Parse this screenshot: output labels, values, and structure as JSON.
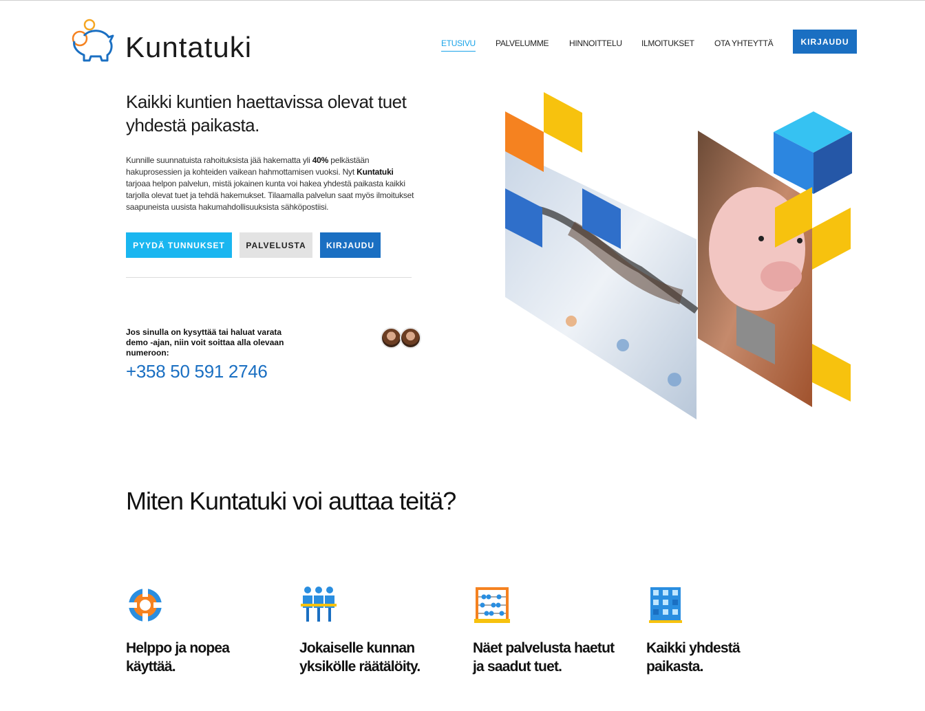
{
  "brand": {
    "name": "Kuntatuki"
  },
  "nav": {
    "items": [
      {
        "label": "ETUSIVU",
        "active": true
      },
      {
        "label": "PALVELUMME",
        "active": false
      },
      {
        "label": "HINNOITTELU",
        "active": false
      },
      {
        "label": "ILMOITUKSET",
        "active": false
      },
      {
        "label": "OTA YHTEYTTÄ",
        "active": false
      }
    ],
    "login_label": "KIRJAUDU"
  },
  "hero": {
    "title": "Kaikki kuntien haettavissa olevat tuet yhdestä paikasta.",
    "text_1": "Kunnille suunnatuista rahoituksista jää hakematta yli ",
    "text_bold_1": "40%",
    "text_2": " pelkästään hakuprosessien ja kohteiden vaikean hahmottamisen vuoksi. Nyt ",
    "text_bold_2": "Kuntatuki",
    "text_3": " tarjoaa helpon palvelun, mistä jokainen kunta voi hakea yhdestä paikasta kaikki tarjolla olevat tuet ja tehdä hakemukset. Tilaamalla palvelun saat myös ilmoitukset saapuneista uusista hakumahdollisuuksista sähköpostiisi.",
    "buttons": {
      "request": "PYYDÄ TUNNUKSET",
      "service": "PALVELUSTA",
      "login": "KIRJAUDU"
    }
  },
  "contact": {
    "text": "Jos sinulla on kysyttää tai haluat varata demo -ajan, niin voit soittaa alla olevaan numeroon:",
    "phone": "+358 50 591 2746"
  },
  "section": {
    "title": "Miten Kuntatuki voi auttaa teitä?",
    "features": [
      {
        "icon": "lifebuoy-icon",
        "title": "Helppo ja nopea käyttää."
      },
      {
        "icon": "team-icon",
        "title": "Jokaiselle kunnan yksikölle räätälöity."
      },
      {
        "icon": "abacus-icon",
        "title": "Näet palvelusta haetut ja saadut tuet."
      },
      {
        "icon": "building-icon",
        "title": "Kaikki yhdestä paikasta."
      }
    ]
  },
  "colors": {
    "accent_blue": "#1a6fc2",
    "accent_cyan": "#1ab6f0",
    "accent_yellow": "#f7c20e",
    "accent_orange": "#f58220"
  }
}
